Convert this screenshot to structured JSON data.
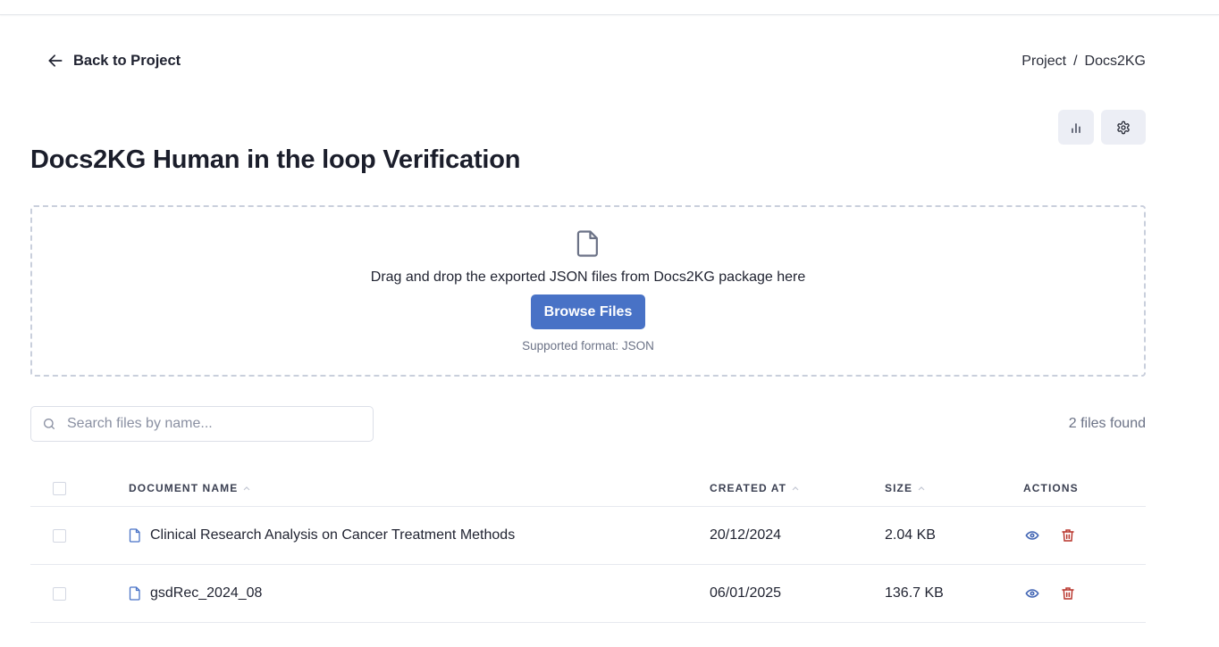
{
  "nav": {
    "back_label": "Back to Project",
    "breadcrumb": [
      "Project",
      "Docs2KG"
    ],
    "breadcrumb_separator": "/"
  },
  "toolbar": {
    "stats_icon": "bar-chart-icon",
    "settings_icon": "gear-icon"
  },
  "page": {
    "title": "Docs2KG Human in the loop Verification"
  },
  "dropzone": {
    "icon": "file-icon",
    "message": "Drag and drop the exported JSON files from Docs2KG package here",
    "browse_label": "Browse Files",
    "hint": "Supported format: JSON"
  },
  "search": {
    "placeholder": "Search files by name...",
    "value": ""
  },
  "file_count": "2 files found",
  "table": {
    "columns": {
      "name": "DOCUMENT NAME",
      "created": "CREATED AT",
      "size": "SIZE",
      "actions": "ACTIONS"
    },
    "rows": [
      {
        "name": "Clinical Research Analysis on Cancer Treatment Methods",
        "created": "20/12/2024",
        "size": "2.04 KB",
        "selected": false
      },
      {
        "name": "gsdRec_2024_08",
        "created": "06/01/2025",
        "size": "136.7 KB",
        "selected": false
      }
    ]
  },
  "colors": {
    "primary": "#4872c6",
    "danger": "#b8352c",
    "view": "#3f63b3",
    "icon_button_bg": "#eceef5"
  }
}
